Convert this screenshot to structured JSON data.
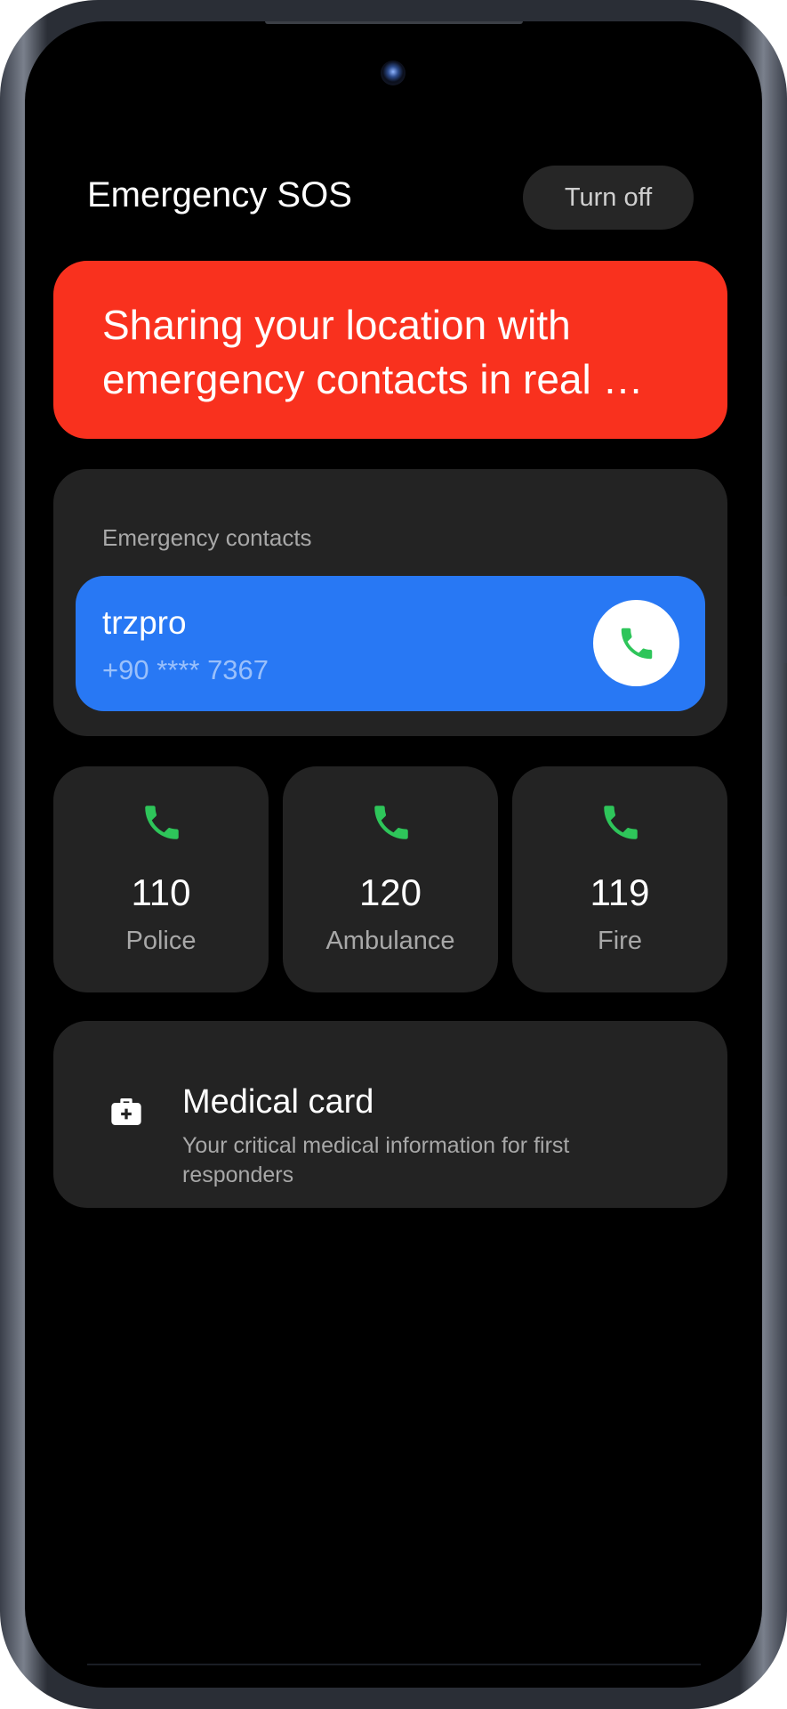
{
  "header": {
    "title": "Emergency SOS",
    "turn_off_label": "Turn off"
  },
  "banner": {
    "text": "Sharing your location with emergency contacts in real …",
    "color": "#f9311e"
  },
  "contacts": {
    "label": "Emergency contacts",
    "items": [
      {
        "name": "trzpro",
        "phone": "+90 **** 7367",
        "icon": "phone-icon"
      }
    ],
    "card_color": "#2878f4"
  },
  "quick_dial": [
    {
      "number": "110",
      "label": "Police",
      "icon": "phone-icon"
    },
    {
      "number": "120",
      "label": "Ambulance",
      "icon": "phone-icon"
    },
    {
      "number": "119",
      "label": "Fire",
      "icon": "phone-icon"
    }
  ],
  "medical": {
    "title": "Medical card",
    "description": "Your critical medical information for first responders",
    "icon": "medical-kit-icon"
  },
  "colors": {
    "background": "#000000",
    "card": "#232323",
    "call_green": "#2ec55a"
  }
}
